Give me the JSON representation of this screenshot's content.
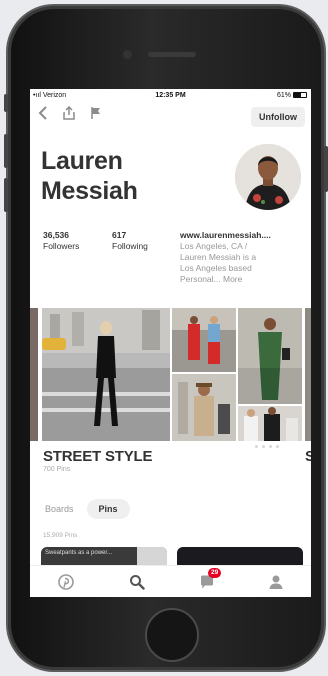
{
  "status_bar": {
    "carrier": "•ııl Verizon ",
    "time": "12:35 PM",
    "battery": "61%"
  },
  "toolbar": {
    "back_icon": "chevron-left-icon",
    "share_icon": "share-icon",
    "report_icon": "flag-icon",
    "unfollow_label": "Unfollow"
  },
  "profile": {
    "name_line1": "Lauren",
    "name_line2": "Messiah",
    "followers_count": "36,536",
    "followers_label": "Followers",
    "following_count": "617",
    "following_label": "Following",
    "website": "www.laurenmessiah....",
    "bio_line1": "Los Angeles, CA /",
    "bio_line2": "Lauren Messiah is a",
    "bio_line3": "Los Angeles based",
    "bio_line4": "Personal... More"
  },
  "board": {
    "title": "STREET STYLE",
    "pin_count": "700 Pins",
    "next_title_initial": "S"
  },
  "tabs": {
    "boards_label": "Boards",
    "pins_label": "Pins",
    "active": "Pins"
  },
  "pins": {
    "count": "15,909 Pins",
    "preview_text": "Sweatpants as a power..."
  },
  "bottom_nav": {
    "home_icon": "pinterest-icon",
    "search_icon": "search-icon",
    "notifications_icon": "chat-bubble-icon",
    "notifications_badge": "29",
    "profile_icon": "person-icon"
  },
  "colors": {
    "brand_red": "#e60023",
    "text_dark": "#333333",
    "text_muted": "#999999",
    "pill_bg": "#efefef"
  }
}
